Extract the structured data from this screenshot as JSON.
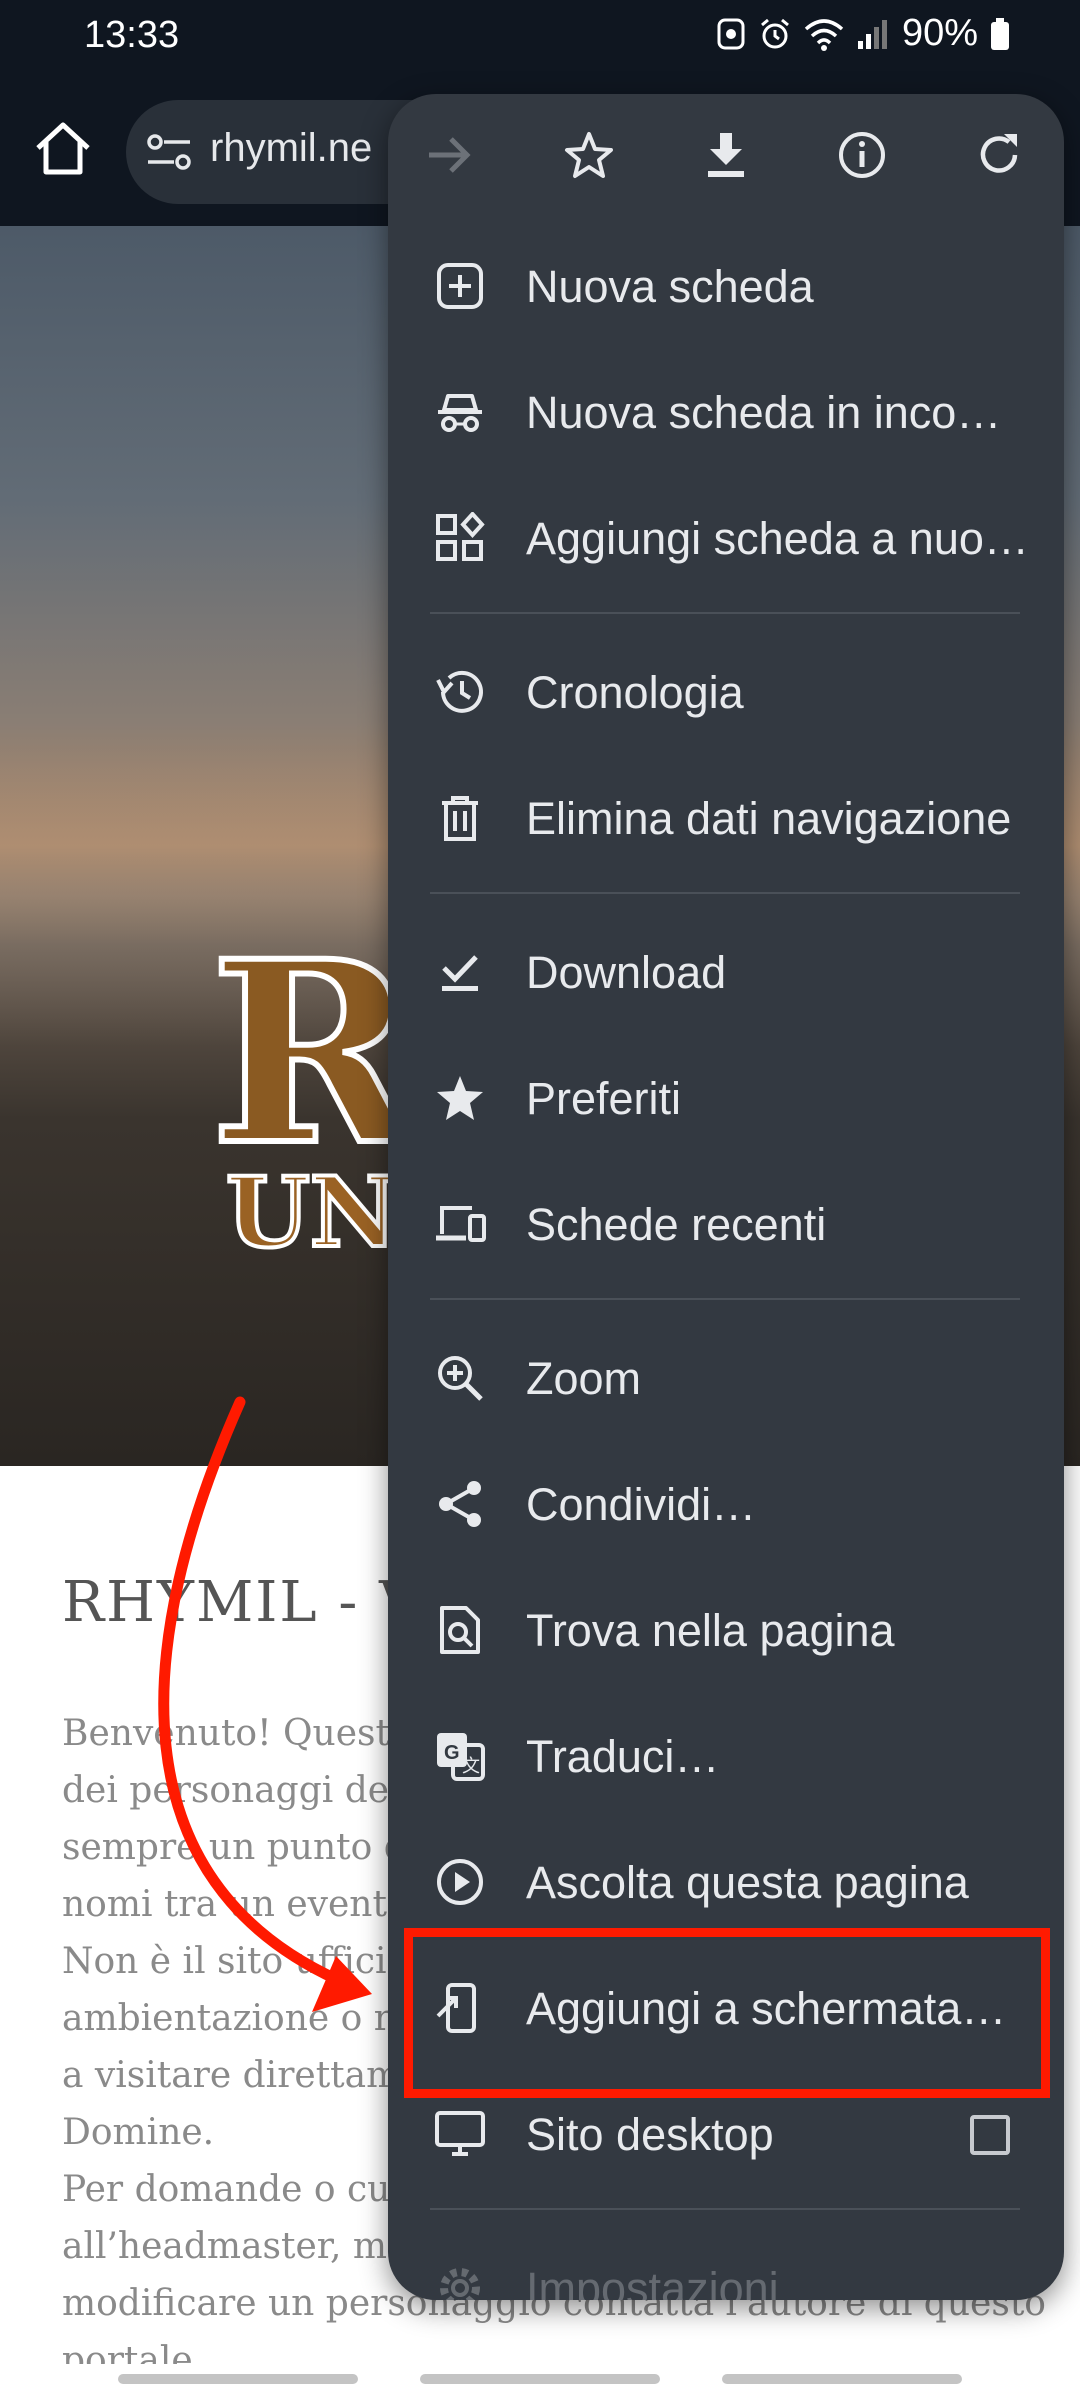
{
  "status_bar": {
    "time": "13:33",
    "battery": "90%"
  },
  "toolbar": {
    "url_text": "rhymil.ne"
  },
  "hero": {
    "logo_text": "RH",
    "logo_sub": "UNA"
  },
  "page": {
    "title": "RHYMIL - VO",
    "body_lines": [
      "Benvenuto! Questo",
      "dei personaggi del",
      "sempre un punto d",
      "nomi tra un evento",
      "Non è il sito ufficia",
      "ambientazione o re",
      "a visitare direttame",
      "Domine.",
      "Per domande o cur",
      "all’headmaster, me",
      "modificare un personaggio contatta l'autore di questo",
      "portale"
    ]
  },
  "menu": {
    "items": [
      {
        "label": "Nuova scheda",
        "icon": "new-tab-icon"
      },
      {
        "label": "Nuova scheda in inco…",
        "icon": "incognito-icon"
      },
      {
        "label": "Aggiungi scheda a nuo…",
        "icon": "tab-group-icon"
      },
      {
        "label": "Cronologia",
        "icon": "history-icon"
      },
      {
        "label": "Elimina dati navigazione",
        "icon": "trash-icon"
      },
      {
        "label": "Download",
        "icon": "download-done-icon"
      },
      {
        "label": "Preferiti",
        "icon": "star-filled-icon"
      },
      {
        "label": "Schede recenti",
        "icon": "devices-icon"
      },
      {
        "label": "Zoom",
        "icon": "zoom-icon"
      },
      {
        "label": "Condividi…",
        "icon": "share-icon"
      },
      {
        "label": "Trova nella pagina",
        "icon": "find-in-page-icon"
      },
      {
        "label": "Traduci…",
        "icon": "translate-icon"
      },
      {
        "label": "Ascolta questa pagina",
        "icon": "play-icon"
      },
      {
        "label": "Aggiungi a schermata…",
        "icon": "add-to-home-icon"
      },
      {
        "label": "Sito desktop",
        "icon": "desktop-icon",
        "checked": false
      },
      {
        "label": "Impostazioni",
        "icon": "settings-icon"
      }
    ]
  },
  "colors": {
    "highlight": "#ff1a00",
    "menu_bg": "#333941",
    "toolbar_bg": "#0f1620"
  }
}
